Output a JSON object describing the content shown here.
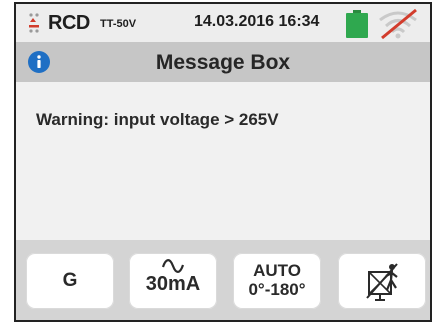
{
  "status_bar": {
    "mode": "RCD",
    "mode_sub": "TT-50V",
    "datetime": "14.03.2016  16:34",
    "icons": [
      "rcd-mode-icon",
      "battery-icon",
      "wireless-disabled-icon"
    ],
    "battery_color": "#2fa84f"
  },
  "title_bar": {
    "title": "Message Box",
    "icon": "info-icon",
    "icon_color": "#1f6fc4"
  },
  "message": "Warning: input voltage > 265V",
  "softkeys": {
    "key1_label": "G",
    "key2_icon": "ac-wave-icon",
    "key2_label": "30mA",
    "key3_line1": "AUTO",
    "key3_line2": "0°-180°",
    "key4_icon": "rcd-test-disabled-icon"
  }
}
